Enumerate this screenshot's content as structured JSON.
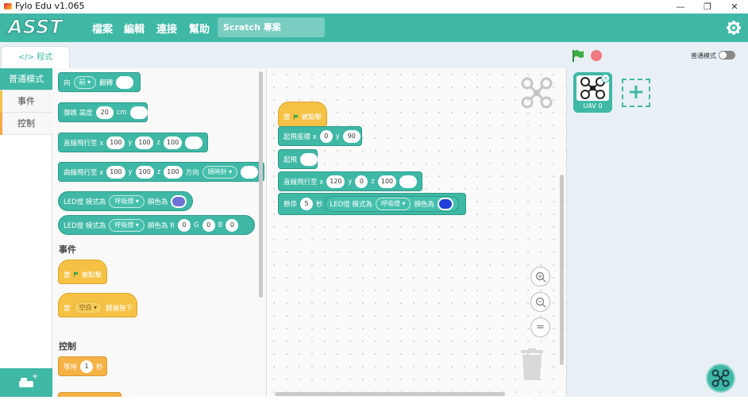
{
  "window": {
    "title": "Fylo Edu v1.065"
  },
  "menubar": {
    "logo_text": "ASST",
    "items": [
      "檔案",
      "編輯",
      "連接",
      "幫助"
    ],
    "project_name": "Scratch 專案"
  },
  "tabs": {
    "program_label": "</> 程式"
  },
  "mode": {
    "label": "普通模式"
  },
  "categories": [
    {
      "label": "普通模式",
      "color": "#3fb8a6"
    },
    {
      "label": "事件",
      "color": "#f5c245"
    },
    {
      "label": "控制",
      "color": "#f5a845"
    }
  ],
  "palette": {
    "blocks": [
      {
        "text": [
          "向",
          "前",
          "翻轉"
        ]
      },
      {
        "text": [
          "彈跳 高度",
          "20",
          "cm"
        ]
      },
      {
        "text": [
          "直線飛行至 x",
          "100",
          "y",
          "100",
          "z",
          "100"
        ]
      },
      {
        "text": [
          "曲線飛行至 x",
          "100",
          "y",
          "100",
          "z",
          "100",
          "方向",
          "順時針"
        ]
      },
      {
        "text": [
          "LED燈 模式為",
          "呼吸燈",
          "顏色為"
        ]
      },
      {
        "text": [
          "LED燈 模式為",
          "呼吸燈",
          "顏色為 R",
          "0",
          "G",
          "0",
          "B",
          "0"
        ]
      }
    ],
    "section_events": "事件",
    "event_blocks": [
      {
        "text": [
          "當",
          "被點擊"
        ]
      },
      {
        "text": [
          "當",
          "空白",
          "鍵被按下"
        ]
      }
    ],
    "section_control": "控制",
    "control_blocks": [
      {
        "text": [
          "等待",
          "1",
          "秒"
        ]
      }
    ]
  },
  "script": {
    "hat": [
      "當",
      "被點擊"
    ],
    "takeoff_coord": [
      "起飛座標 x",
      "0",
      "y",
      "90"
    ],
    "takeoff": "起飛",
    "fly_to": [
      "直線飛行至 x",
      "120",
      "y",
      "0",
      "z",
      "100"
    ],
    "hover": [
      "懸停",
      "5",
      "秒"
    ],
    "led": [
      "LED燈 模式為",
      "呼吸燈",
      "顏色為"
    ]
  },
  "zoom": {
    "reset": "="
  },
  "sprite": {
    "name": "UAV 0"
  },
  "colors": {
    "accent": "#3fb8a6",
    "event": "#f5c245",
    "led_purple": "#6e72d6",
    "led_blue": "#1f3fd6"
  }
}
